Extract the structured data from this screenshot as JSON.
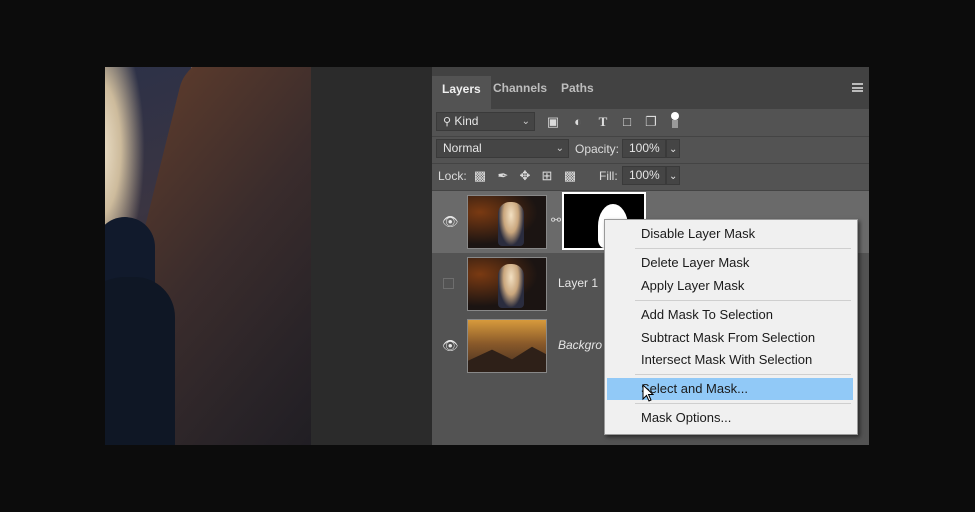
{
  "panel": {
    "tabs": [
      "Layers",
      "Channels",
      "Paths"
    ],
    "active_tab": "Layers",
    "filter_kind": "Kind",
    "blend_mode": "Normal",
    "opacity_label": "Opacity:",
    "opacity_value": "100%",
    "lock_label": "Lock:",
    "fill_label": "Fill:",
    "fill_value": "100%",
    "filter_icons": [
      "image-icon",
      "adjustment-icon",
      "type-icon",
      "shape-icon",
      "smart-object-icon",
      "toggle-dot-icon"
    ],
    "lock_icons": [
      "lock-transparent-icon",
      "lock-brush-icon",
      "lock-move-icon",
      "lock-artboard-icon",
      "lock-all-icon"
    ]
  },
  "layers": [
    {
      "name": "",
      "visible": true,
      "has_mask": true,
      "selected": true
    },
    {
      "name": "Layer 1",
      "visible": false,
      "has_mask": false,
      "selected": false
    },
    {
      "name": "Backgro",
      "visible": true,
      "has_mask": false,
      "selected": false,
      "italic": true
    }
  ],
  "context_menu": {
    "items": [
      "Disable Layer Mask",
      "Delete Layer Mask",
      "Apply Layer Mask",
      "Add Mask To Selection",
      "Subtract Mask From Selection",
      "Intersect Mask With Selection",
      "Select and Mask...",
      "Mask Options..."
    ],
    "highlighted": "Select and Mask..."
  },
  "colors": {
    "panel_bg": "#535353",
    "menu_bg": "#f0f0f0",
    "menu_highlight": "#91c9f7"
  }
}
